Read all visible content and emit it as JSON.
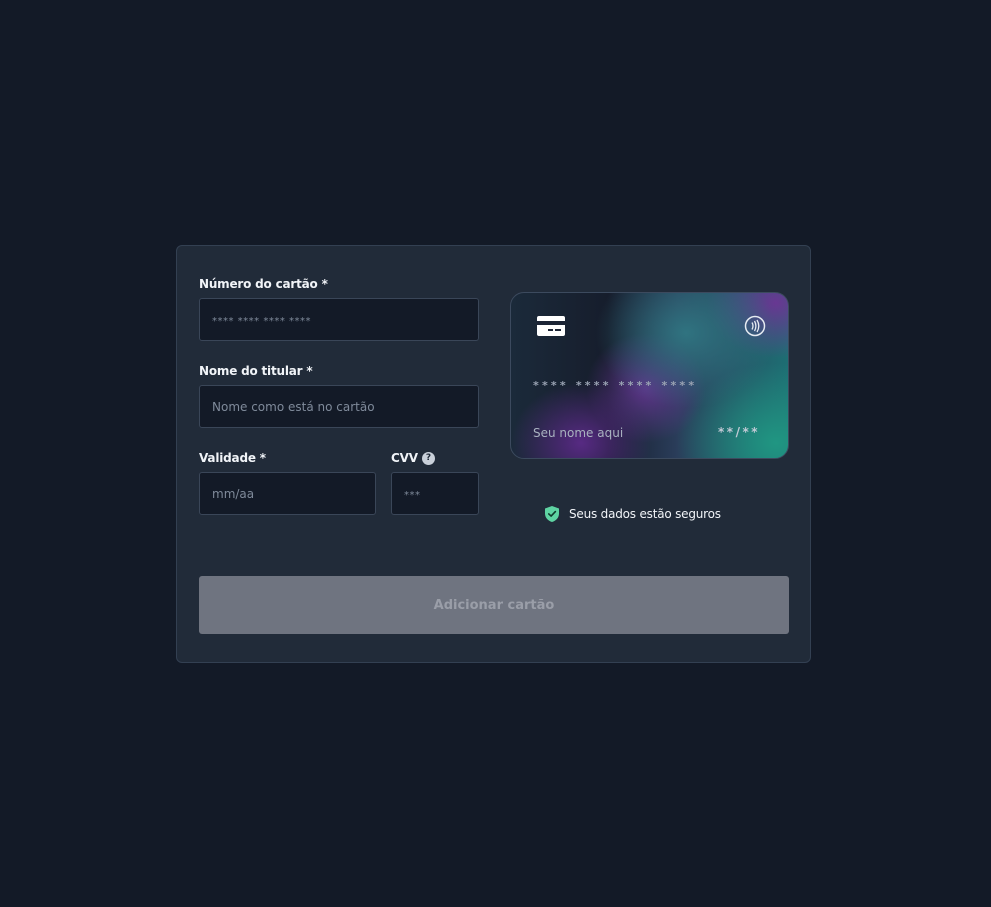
{
  "form": {
    "card_number": {
      "label": "Número do cartão *",
      "placeholder": "**** **** **** ****",
      "value": ""
    },
    "holder_name": {
      "label": "Nome do titular *",
      "placeholder": "Nome como está no cartão",
      "value": ""
    },
    "expiry": {
      "label": "Validade *",
      "placeholder": "mm/aa",
      "value": ""
    },
    "cvv": {
      "label": "CVV",
      "placeholder": "***",
      "value": "",
      "help_icon": "question-circle-icon",
      "help_symbol": "?"
    }
  },
  "card_preview": {
    "chip_icon": "credit-card-icon",
    "contactless_icon": "contactless-icon",
    "number": "**** **** **** ****",
    "name": "Seu nome aqui",
    "expiry": "**/**"
  },
  "security": {
    "icon": "shield-check-icon",
    "text": "Seus dados estão seguros",
    "icon_color": "#5ed3a2"
  },
  "submit": {
    "label": "Adicionar cartão",
    "disabled": true
  },
  "colors": {
    "background": "#131a27",
    "panel": "#212b39",
    "input_bg": "#131a27",
    "button_disabled": "#6f7480"
  }
}
